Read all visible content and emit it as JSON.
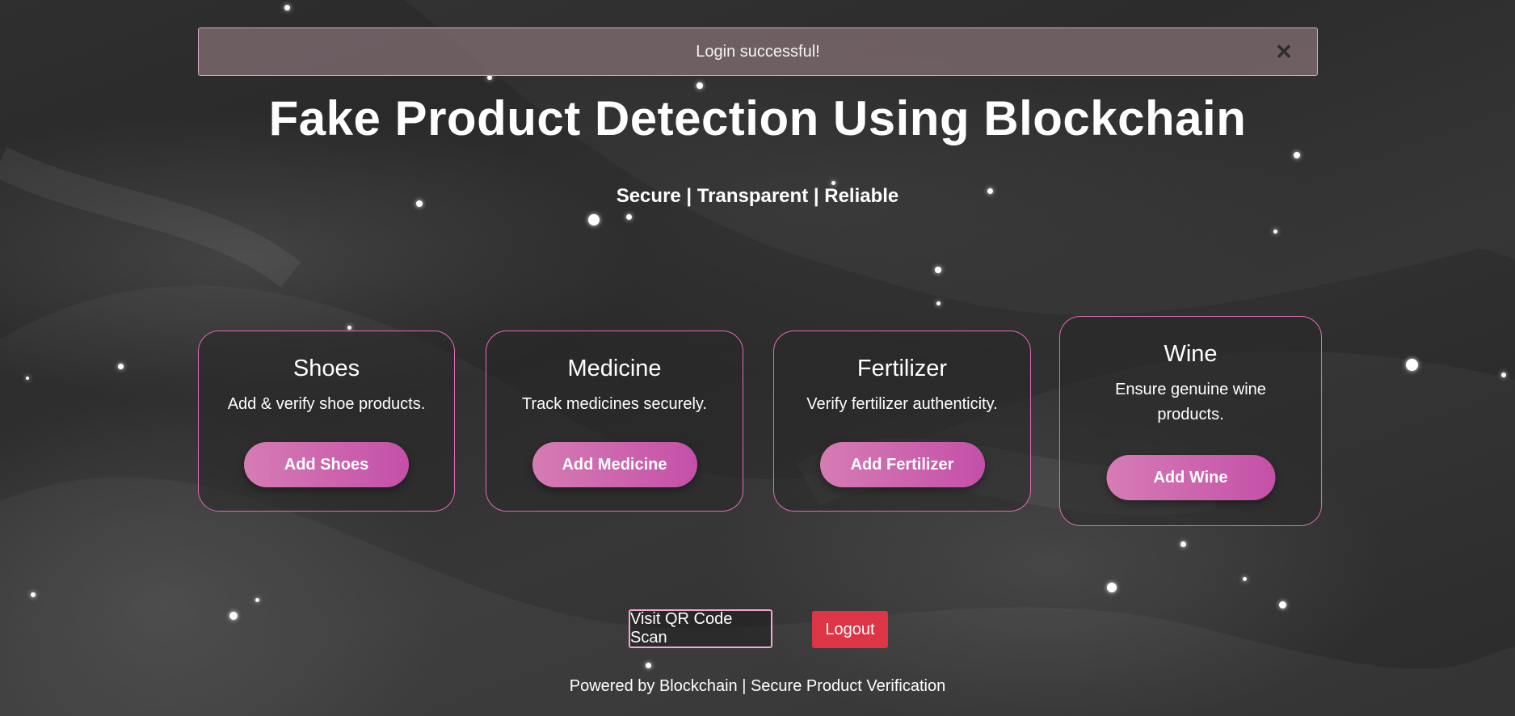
{
  "alert": {
    "message": "Login successful!",
    "close_symbol": "✕"
  },
  "header": {
    "title": "Fake Product Detection Using Blockchain",
    "tagline": "Secure | Transparent | Reliable"
  },
  "cards": [
    {
      "title": "Shoes",
      "description": "Add & verify shoe products.",
      "button_label": "Add Shoes"
    },
    {
      "title": "Medicine",
      "description": "Track medicines securely.",
      "button_label": "Add Medicine"
    },
    {
      "title": "Fertilizer",
      "description": "Verify fertilizer authenticity.",
      "button_label": "Add Fertilizer"
    },
    {
      "title": "Wine",
      "description": "Ensure genuine wine products.",
      "button_label": "Add Wine"
    }
  ],
  "actions": {
    "qr_label": "Visit QR Code Scan",
    "logout_label": "Logout"
  },
  "footer": {
    "text": "Powered by Blockchain | Secure Product Verification"
  },
  "colors": {
    "card_border": "#e16bb7",
    "button_gradient_start": "#d67cb4",
    "button_gradient_end": "#c450a8",
    "logout_bg": "#dc3545",
    "alert_border": "#d9a7c7"
  }
}
